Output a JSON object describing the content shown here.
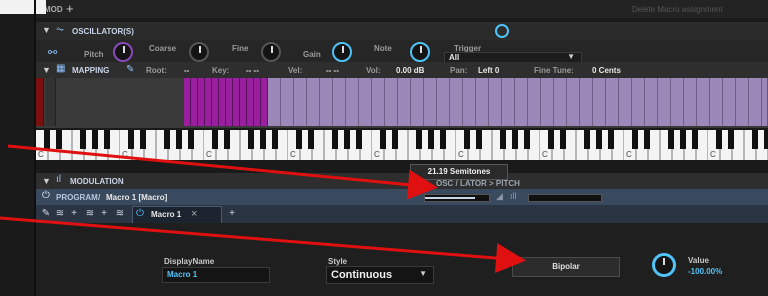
{
  "mod_strip": {
    "label": "MOD",
    "add": "+",
    "delete_text": "Delete Macro assignment"
  },
  "oscillator": {
    "title": "OSCILLATOR(S)",
    "knobs": [
      {
        "label": "Pitch"
      },
      {
        "label": "Coarse"
      },
      {
        "label": "Fine"
      },
      {
        "label": "Gain"
      },
      {
        "label": "Note"
      }
    ],
    "trigger_label": "Trigger",
    "trigger_value": "All"
  },
  "mapping": {
    "title": "MAPPING",
    "root_label": "Root:",
    "root_value": "--",
    "key_label": "Key:",
    "key_value": "-- --",
    "vel_label": "Vel:",
    "vel_value": "-- --",
    "vol_label": "Vol:",
    "vol_value": "0.00 dB",
    "pan_label": "Pan:",
    "pan_value": "Left 0",
    "tune_label": "Fine Tune:",
    "tune_value": "0 Cents",
    "octave_labels": [
      "C",
      "C",
      "C",
      "C",
      "C",
      "C",
      "C",
      "C",
      "C"
    ]
  },
  "tooltip": {
    "text": "21.19 Semitones"
  },
  "modulation": {
    "title": "MODULATION",
    "breadcrumb_root": "PROGRAM",
    "breadcrumb_sep": "/",
    "breadcrumb_current": "Macro 1 [Macro]",
    "route_path": "OSC / LATOR > PITCH",
    "tab_label": "Macro 1",
    "tab_close": "×"
  },
  "macro": {
    "display_name_label": "DisplayName",
    "display_name_value": "Macro 1",
    "style_label": "Style",
    "style_value": "Continuous",
    "polarity_button": "Bipolar",
    "value_label": "Value",
    "value_value": "-100.00%"
  },
  "colors": {
    "accent": "#4fc3f7",
    "mapped_magenta": "#9a1f9e",
    "mapped_lavender": "#9b87b8",
    "arrow": "#e01010"
  }
}
